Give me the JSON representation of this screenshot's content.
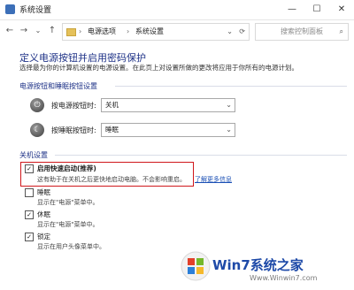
{
  "window": {
    "title": "系统设置"
  },
  "nav": {
    "back_icon": "back-arrow",
    "forward_icon": "forward-arrow",
    "up_icon": "up-arrow",
    "address": {
      "sep1": "›",
      "crumb1": "电源选项",
      "sep2": "›",
      "crumb2": "系统设置",
      "chev": "⌄"
    },
    "search_placeholder": "搜索控制面板"
  },
  "page": {
    "title": "定义电源按钮并启用密码保护",
    "description": "选择最为你的计算机设置的电源设置。在此页上对设置所做的更改将应用于你所有的电源计划。"
  },
  "power_section": {
    "title": "电源按钮和睡眠按钮设置",
    "rows": [
      {
        "label": "按电源按钮时:",
        "value": "关机"
      },
      {
        "label": "按睡眠按钮时:",
        "value": "睡眠"
      }
    ]
  },
  "shutdown_section": {
    "title": "关机设置",
    "fast_startup": {
      "label": "启用快速启动(推荐)",
      "checked": true,
      "desc": "这有助于在关机之后更快地启动电脑。不会影响重启。",
      "link": "了解更多信息"
    },
    "options": [
      {
        "label": "睡眠",
        "checked": false,
        "desc": "显示在\"电源\"菜单中。"
      },
      {
        "label": "休眠",
        "checked": true,
        "desc": "显示在\"电源\"菜单中。"
      },
      {
        "label": "锁定",
        "checked": true,
        "desc": "显示在用户头像菜单中。"
      }
    ]
  },
  "watermark": {
    "brand": "Win7系统之家",
    "url": "Www.Winwin7.com"
  },
  "colors": {
    "heading": "#1e3287",
    "highlight_box": "#d0161b",
    "link": "#1a4fb5"
  }
}
